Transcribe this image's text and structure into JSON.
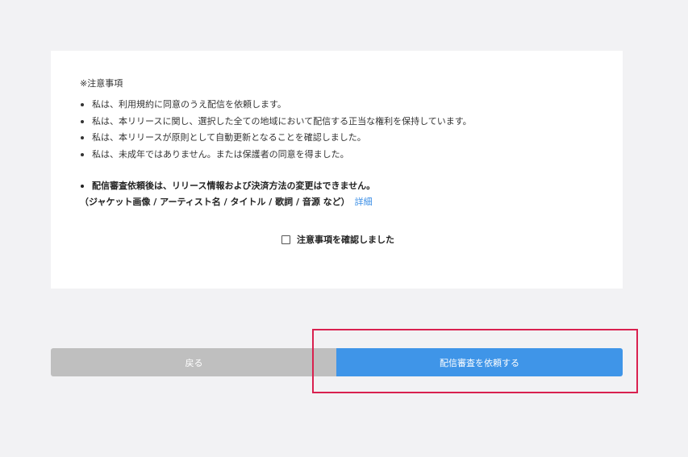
{
  "notice": {
    "heading": "※注意事項",
    "items": [
      "私は、利用規約に同意のうえ配信を依頼します。",
      "私は、本リリースに関し、選択した全ての地域において配信する正当な権利を保持しています。",
      "私は、本リリースが原則として自動更新となることを確認しました。",
      "私は、未成年ではありません。または保護者の同意を得ました。"
    ],
    "warning_line1": "配信審査依頼後は、リリース情報および決済方法の変更はできません。",
    "warning_line2": "（ジャケット画像 / アーティスト名 / タイトル / 歌詞 / 音源 など）",
    "detail_link": "詳細"
  },
  "confirm": {
    "label": "注意事項を確認しました",
    "checked": false
  },
  "actions": {
    "back_label": "戻る",
    "submit_label": "配信審査を依頼する"
  },
  "colors": {
    "page_background": "#f2f2f4",
    "card_background": "#ffffff",
    "back_button": "#bfbfbf",
    "submit_button": "#3f95e8",
    "link": "#3a8ee6",
    "highlight": "#d9214f"
  }
}
